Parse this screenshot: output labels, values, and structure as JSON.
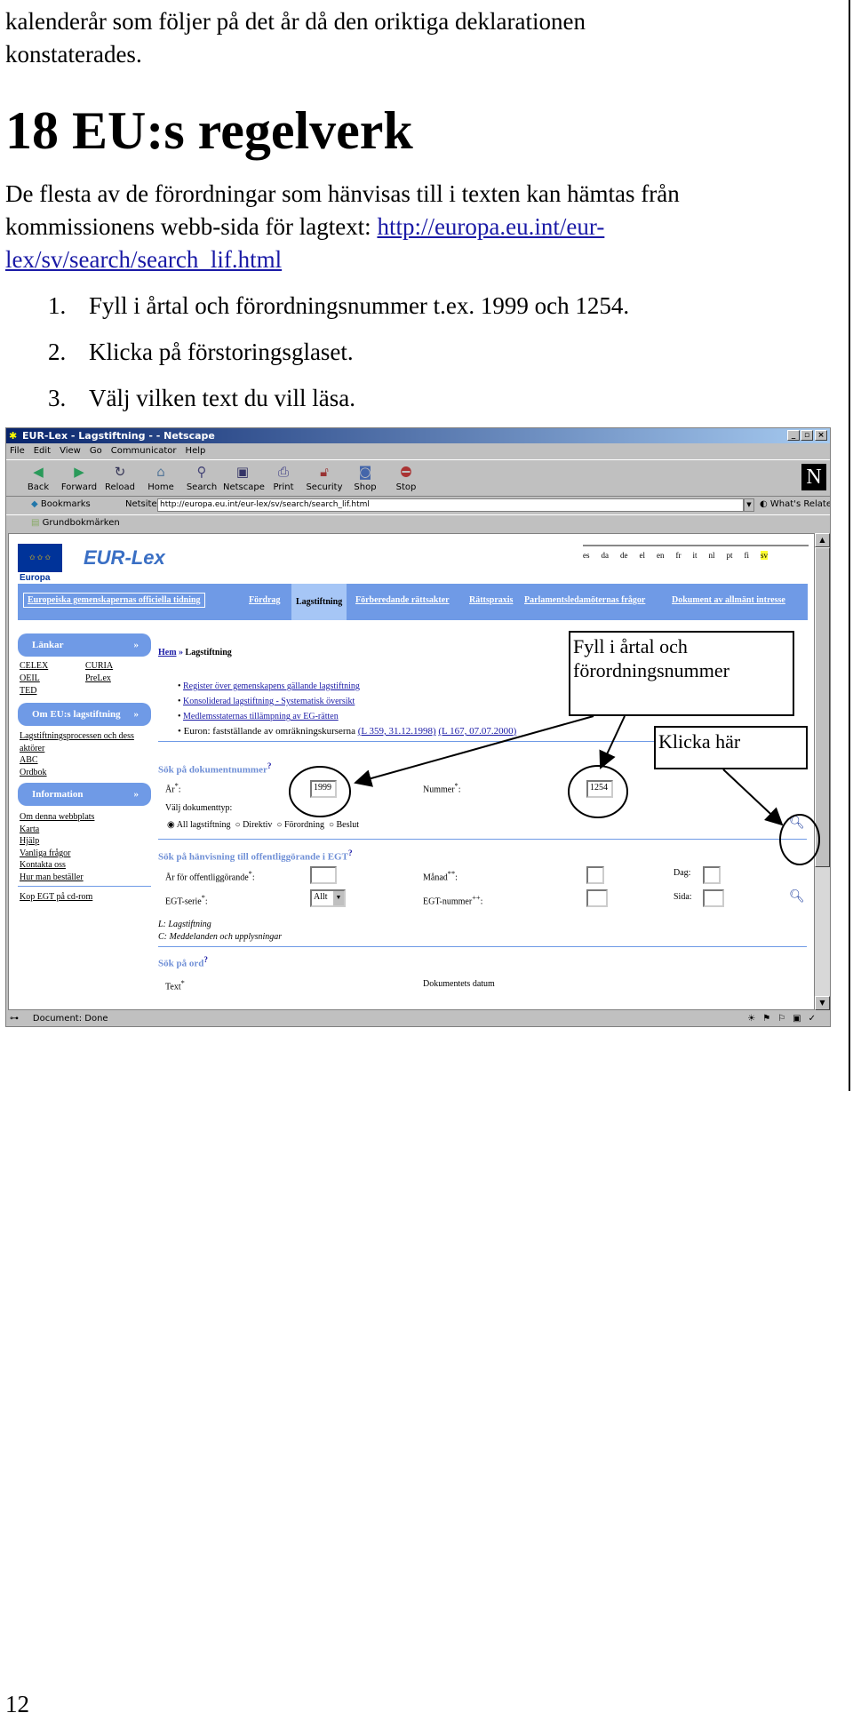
{
  "document": {
    "intro_line1": "kalenderår som följer på det år då den oriktiga deklarationen",
    "intro_line2": "konstaterades.",
    "heading": "18 EU:s regelverk",
    "para_line1": "De flesta av de förordningar som hänvisas till i texten kan hämtas från",
    "para_line2": "kommissionens webb-sida för lagtext: ",
    "link_part1": "http://europa.eu.int/eur-",
    "link_part2": "lex/sv/search/search_lif.html",
    "steps": [
      {
        "num": "1.",
        "text": "Fyll i årtal och förordningsnummer t.ex. 1999 och 1254."
      },
      {
        "num": "2.",
        "text": "Klicka på förstoringsglaset."
      },
      {
        "num": "3.",
        "text": "Välj vilken text du vill läsa."
      }
    ],
    "page_number": "12"
  },
  "browser": {
    "title": "EUR-Lex - Lagstiftning - - Netscape",
    "menu": [
      "File",
      "Edit",
      "View",
      "Go",
      "Communicator",
      "Help"
    ],
    "toolbar": [
      {
        "label": "Back",
        "icon": "back-arrow"
      },
      {
        "label": "Forward",
        "icon": "forward-arrow"
      },
      {
        "label": "Reload",
        "icon": "reload"
      },
      {
        "label": "Home",
        "icon": "home"
      },
      {
        "label": "Search",
        "icon": "search"
      },
      {
        "label": "Netscape",
        "icon": "netscape"
      },
      {
        "label": "Print",
        "icon": "printer"
      },
      {
        "label": "Security",
        "icon": "lock"
      },
      {
        "label": "Shop",
        "icon": "shop-bag"
      },
      {
        "label": "Stop",
        "icon": "stop"
      }
    ],
    "bookmarks_label": "Bookmarks",
    "netsite_label": "Netsite:",
    "url": "http://europa.eu.int/eur-lex/sv/search/search_lif.html",
    "whats_related": "What's Related",
    "personal_bookmark": "Grundbokmärken",
    "status": "Document: Done"
  },
  "page": {
    "europa_label": "Europa",
    "logo_text": "EUR-Lex",
    "languages": [
      "es",
      "da",
      "de",
      "el",
      "en",
      "fr",
      "it",
      "nl",
      "pt",
      "fi",
      "sv"
    ],
    "selected_language": "sv",
    "nav": [
      "Europeiska gemenskapernas officiella tidning",
      "Fördrag",
      "Lagstiftning",
      "Förberedande rättsakter",
      "Rättspraxis",
      "Parlamentsledamöternas frågor",
      "Dokument av allmänt intresse"
    ],
    "sidebar": {
      "links_header": "Länkar",
      "links": [
        "CELEX",
        "CURIA",
        "OEIL",
        "PreLex",
        "TED"
      ],
      "about_header": "Om EU:s lagstiftning",
      "about_links": [
        "Lagstiftningsprocessen och dess",
        "aktörer",
        "ABC",
        "Ordbok"
      ],
      "info_header": "Information",
      "info_links": [
        "Om denna webbplats",
        "Karta",
        "Hjälp",
        "Vanliga frågor",
        "Kontakta oss",
        "Hur man beställer"
      ],
      "buy_link": "Kop EGT på cd-rom"
    },
    "breadcrumb": {
      "home": "Hem",
      "sep": "»",
      "current": "Lagstiftning"
    },
    "bullets": [
      "Register över gemenskapens gällande lagstiftning",
      "Konsoliderad lagstiftning - Systematisk översikt",
      "Medlemsstaternas tillämpning av EG-rätten"
    ],
    "euro_text": "Euron: fastställande av omräkningskurserna ",
    "euro_links": [
      "(L 359, 31.12.1998)",
      "(L 167, 07.07.2000)"
    ],
    "sec1": {
      "title": "Sök på dokumentnummer",
      "help": "?",
      "year_label": "År",
      "year_value": "1999",
      "number_label": "Nummer",
      "number_value": "1254",
      "type_label": "Välj dokumenttyp:",
      "types": [
        "All lagstiftning",
        "Direktiv",
        "Förordning",
        "Beslut"
      ],
      "selected_type": "All lagstiftning"
    },
    "sec2": {
      "title": "Sök på hänvisning till offentliggörande i EGT",
      "help": "?",
      "year_label": "År för offentliggörande",
      "month_label": "Månad",
      "day_label": "Dag:",
      "series_label": "EGT-serie",
      "series_value": "Allt",
      "egt_number_label": "EGT-nummer",
      "page_label": "Sida:",
      "note1": "L: Lagstiftning",
      "note2": "C: Meddelanden och upplysningar"
    },
    "sec3": {
      "title": "Sök på ord",
      "help": "?",
      "text_label": "Text",
      "date_label": "Dokumentets datum"
    }
  },
  "callouts": {
    "fill_in": "Fyll i årtal och förordningsnummer",
    "click_here": "Klicka här"
  }
}
